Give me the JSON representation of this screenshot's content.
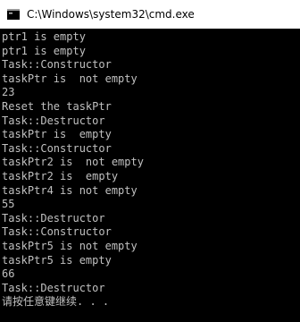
{
  "window": {
    "title": "C:\\Windows\\system32\\cmd.exe",
    "icon": "console-app-icon"
  },
  "console": {
    "lines": [
      "ptr1 is empty",
      "ptr1 is empty",
      "Task::Constructor",
      "taskPtr is  not empty",
      "23",
      "Reset the taskPtr",
      "Task::Destructor",
      "taskPtr is  empty",
      "Task::Constructor",
      "taskPtr2 is  not empty",
      "taskPtr2 is  empty",
      "taskPtr4 is not empty",
      "55",
      "Task::Destructor",
      "Task::Constructor",
      "taskPtr5 is not empty",
      "taskPtr5 is empty",
      "66",
      "Task::Destructor",
      "请按任意键继续. . ."
    ]
  },
  "colors": {
    "background": "#000000",
    "text": "#c0c0c0",
    "titlebar": "#ffffff"
  }
}
